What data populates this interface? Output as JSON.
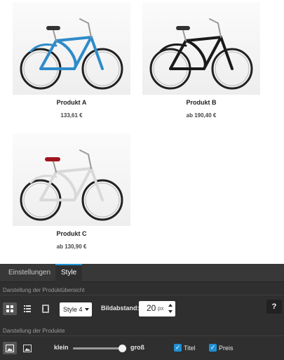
{
  "products": [
    {
      "title": "Produkt A",
      "price": "133,61 €",
      "frame_color": "#2e8bc9"
    },
    {
      "title": "Produkt B",
      "price": "ab 190,40 €",
      "frame_color": "#1a1a1a"
    },
    {
      "title": "Produkt C",
      "price": "ab 130,90 €",
      "frame_color": "#e8e8e8"
    }
  ],
  "panel": {
    "tabs": [
      {
        "label": "Einstellungen",
        "active": false
      },
      {
        "label": "Style",
        "active": true
      }
    ],
    "overview_section": "Darstellung der Produktübersicht",
    "layout_buttons": [
      {
        "icon": "grid-icon",
        "active": true
      },
      {
        "icon": "list-icon",
        "active": false
      },
      {
        "icon": "slider-icon",
        "active": false
      }
    ],
    "style_select": {
      "value": "Style 4"
    },
    "spacing": {
      "label": "Bildabstand:",
      "value": "20",
      "unit": "px"
    },
    "help_label": "?",
    "products_section": "Darstellung der Produkte",
    "image_buttons": [
      {
        "icon": "image-small-icon",
        "active": true
      },
      {
        "icon": "image-large-icon",
        "active": false
      }
    ],
    "size_slider": {
      "min_label": "klein",
      "max_label": "groß",
      "value_fraction": 1.0
    },
    "checkboxes": [
      {
        "label": "Titel",
        "checked": true
      },
      {
        "label": "Preis",
        "checked": true
      }
    ],
    "accent_color": "#1e90d6"
  }
}
